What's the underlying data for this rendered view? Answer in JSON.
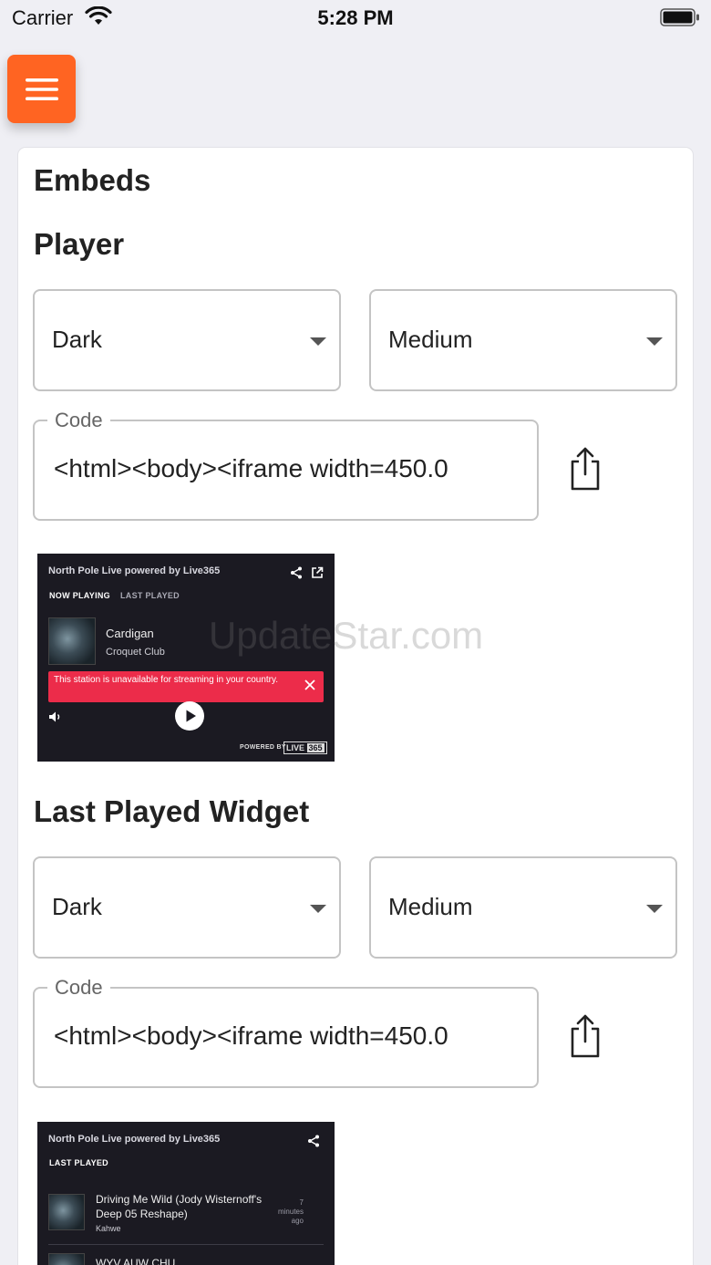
{
  "status_bar": {
    "carrier": "Carrier",
    "time": "5:28 PM"
  },
  "menu": {
    "icon": "hamburger-icon",
    "color": "#ff6422"
  },
  "page": {
    "title": "Embeds",
    "watermark": "UpdateStar.com"
  },
  "player": {
    "heading": "Player",
    "theme_select": "Dark",
    "size_select": "Medium",
    "code_label": "Code",
    "code_value": "<html><body><iframe width=450.0",
    "preview": {
      "station_title": "North Pole Live powered by Live365",
      "tab_now_playing": "NOW PLAYING",
      "tab_last_played": "LAST PLAYED",
      "song": "Cardigan",
      "artist": "Croquet Club",
      "alert": "This station is unavailable for streaming in your country.",
      "powered_by": "POWERED BY",
      "brand_left": "LIVE",
      "brand_right": "365",
      "alert_color": "#ec2c4a"
    }
  },
  "last_played": {
    "heading": "Last Played Widget",
    "theme_select": "Dark",
    "size_select": "Medium",
    "code_label": "Code",
    "code_value": "<html><body><iframe width=450.0",
    "preview": {
      "station_title": "North Pole Live powered by Live365",
      "tab_label": "LAST PLAYED",
      "items": [
        {
          "title_line1": "Driving Me Wild (Jody Wisternoff's",
          "title_line2": "Deep 05 Reshape)",
          "artist": "Kahwe",
          "ago_num": "7",
          "ago_unit": "minutes",
          "ago_word": "ago"
        },
        {
          "title_line1": "WYV AUW CHU",
          "title_line2": "",
          "artist": "",
          "ago_num": "",
          "ago_unit": "",
          "ago_word": ""
        }
      ]
    }
  }
}
